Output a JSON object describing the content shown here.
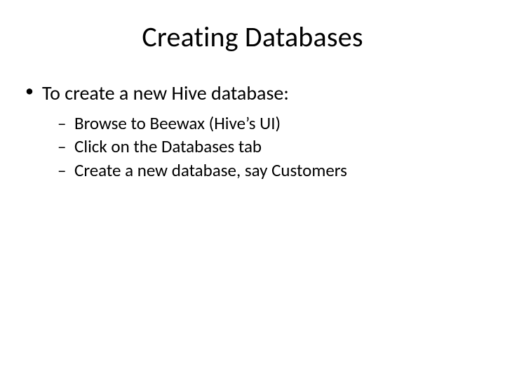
{
  "title": "Creating Databases",
  "bullets": {
    "main": "To create a new Hive database:",
    "subs": [
      "Browse to Beewax (Hive’s UI)",
      "Click on the Databases tab",
      "Create a new database, say Customers"
    ]
  }
}
